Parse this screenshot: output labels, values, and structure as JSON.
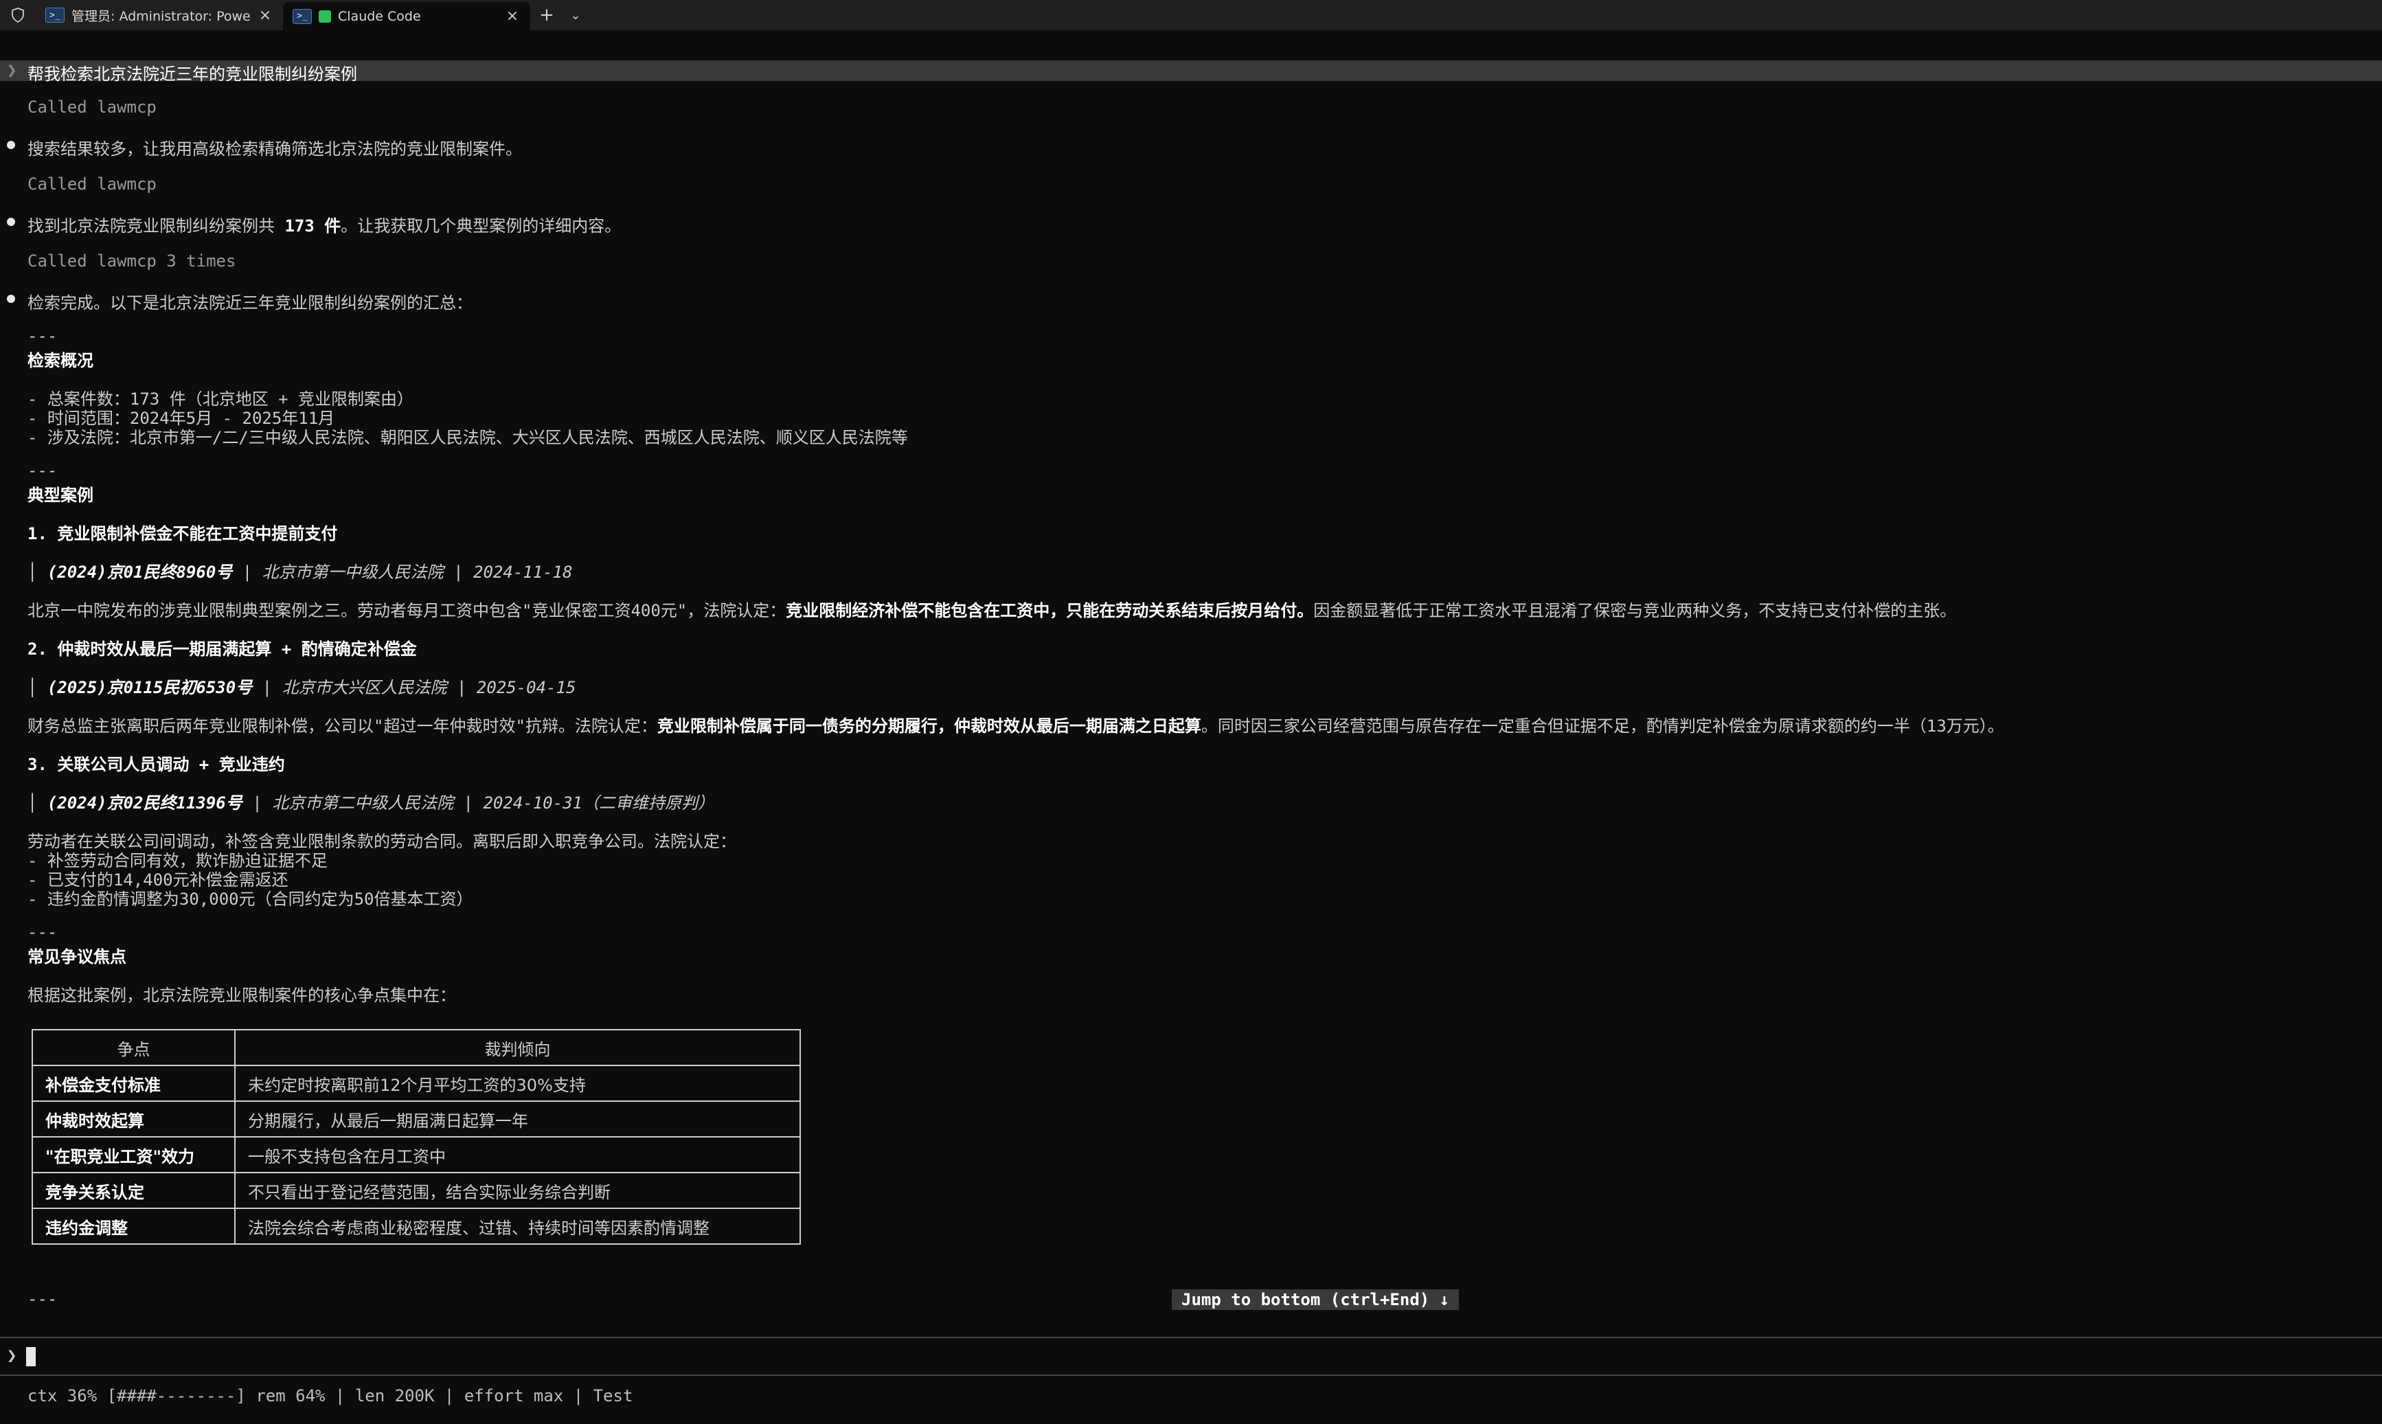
{
  "titlebar": {
    "tabs": [
      {
        "label": "管理员: Administrator: PowerSh",
        "close": "×"
      },
      {
        "label": "Claude Code",
        "close": "×"
      }
    ],
    "new_tab": "+",
    "dropdown": "⌄"
  },
  "prompt": "帮我检索北京法院近三年的竞业限制纠纷案例",
  "called1": "Called lawmcp",
  "msg1": "搜索结果较多，让我用高级检索精确筛选北京法院的竞业限制案件。",
  "called2": "Called lawmcp",
  "msg2_pre": "找到北京法院竞业限制纠纷案例共 ",
  "msg2_bold": "173 件",
  "msg2_post": "。让我获取几个典型案例的详细内容。",
  "called3": "Called lawmcp 3 times",
  "msg3": "检索完成。以下是北京法院近三年竞业限制纠纷案例的汇总：",
  "hr": "---",
  "overview": {
    "heading": "检索概况",
    "items": [
      "- 总案件数：173 件（北京地区 + 竞业限制案由）",
      "- 时间范围：2024年5月 - 2025年11月",
      "- 涉及法院：北京市第一/二/三中级人民法院、朝阳区人民法院、大兴区人民法院、西城区人民法院、顺义区人民法院等"
    ]
  },
  "cases": {
    "heading": "典型案例",
    "case1": {
      "title": "1. 竞业限制补偿金不能在工资中提前支付",
      "cite_no": "(2024)京01民终8960号",
      "cite_court": "北京市第一中级人民法院",
      "cite_date": "2024-11-18",
      "body_pre": "北京一中院发布的涉竞业限制典型案例之三。劳动者每月工资中包含\"竞业保密工资400元\"，法院认定：",
      "body_bold": "竞业限制经济补偿不能包含在工资中，只能在劳动关系结束后按月给付。",
      "body_post": "因金额显著低于正常工资水平且混淆了保密与竞业两种义务，不支持已支付补偿的主张。"
    },
    "case2": {
      "title": "2. 仲裁时效从最后一期届满起算 + 酌情确定补偿金",
      "cite_no": "(2025)京0115民初6530号",
      "cite_court": "北京市大兴区人民法院",
      "cite_date": "2025-04-15",
      "body_pre": "财务总监主张离职后两年竞业限制补偿，公司以\"超过一年仲裁时效\"抗辩。法院认定：",
      "body_bold": "竞业限制补偿属于同一债务的分期履行，仲裁时效从最后一期届满之日起算",
      "body_post": "。同时因三家公司经营范围与原告存在一定重合但证据不足，酌情判定补偿金为原请求额的约一半（13万元）。"
    },
    "case3": {
      "title": "3. 关联公司人员调动 + 竞业违约",
      "cite_no": "(2024)京02民终11396号",
      "cite_court": "北京市第二中级人民法院",
      "cite_date": "2024-10-31（二审维持原判）",
      "body_lines": [
        "劳动者在关联公司间调动，补签含竞业限制条款的劳动合同。离职后即入职竞争公司。法院认定：",
        "- 补签劳动合同有效，欺诈胁迫证据不足",
        "- 已支付的14,400元补偿金需返还",
        "- 违约金酌情调整为30,000元（合同约定为50倍基本工资）"
      ]
    }
  },
  "disputes": {
    "heading": "常见争议焦点",
    "intro": "根据这批案例，北京法院竞业限制案件的核心争点集中在：",
    "headers": [
      "争点",
      "裁判倾向"
    ],
    "rows": [
      [
        "补偿金支付标准",
        "未约定时按离职前12个月平均工资的30%支持"
      ],
      [
        "仲裁时效起算",
        "分期履行，从最后一期届满日起算一年"
      ],
      [
        "\"在职竞业工资\"效力",
        "一般不支持包含在月工资中"
      ],
      [
        "竞争关系认定",
        "不只看出于登记经营范围，结合实际业务综合判断"
      ],
      [
        "违约金调整",
        "法院会综合考虑商业秘密程度、过错、持续时间等因素酌情调整"
      ]
    ]
  },
  "jump_button": "Jump to bottom (ctrl+End) ↓",
  "input_caret": "❯",
  "status_line": "ctx 36% [####--------] rem 64% | len 200K | effort max | Test"
}
